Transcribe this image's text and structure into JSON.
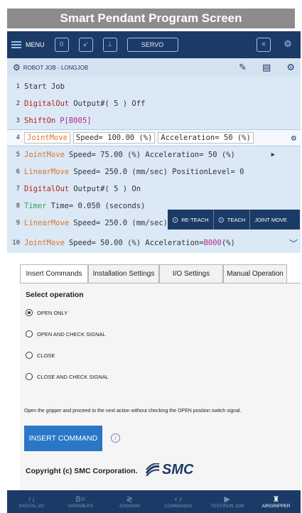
{
  "caption": "Smart Pendant Program Screen",
  "topbar": {
    "menu_label": "MENU",
    "servo_label": "SERVO"
  },
  "jobbar": {
    "title": "ROBOT JOB - LONGJOB"
  },
  "job_lines": [
    {
      "num": "1",
      "cmd": "Start Job",
      "cmd_color": "plain",
      "rest": ""
    },
    {
      "num": "2",
      "cmd": "DigitalOut",
      "cmd_color": "red",
      "rest": "Output#( 5 )  Off"
    },
    {
      "num": "3",
      "cmd": "ShiftOn",
      "cmd_color": "red",
      "rest": "P[B005]"
    },
    {
      "num": "4",
      "cmd": "JointMove",
      "cmd_color": "orange",
      "speed": "Speed= 100.00 (%)",
      "accel": "Acceleration= 50 (%)"
    },
    {
      "num": "5",
      "cmd": "JointMove",
      "cmd_color": "orange",
      "rest": "Speed= 75.00 (%)  Acceleration= 50 (%)"
    },
    {
      "num": "6",
      "cmd": "LinearMove",
      "cmd_color": "orange",
      "rest": "Speed= 250.0 (mm/sec)  PositionLevel= 0"
    },
    {
      "num": "7",
      "cmd": "DigitalOut",
      "cmd_color": "red",
      "rest": "Output#( 5 )  On"
    },
    {
      "num": "8",
      "cmd": "Timer",
      "cmd_color": "green",
      "rest": "Time= 0.050 (seconds)"
    },
    {
      "num": "9",
      "cmd": "LinearMove",
      "cmd_color": "orange",
      "rest": "Speed= 250.0 (mm/sec)"
    },
    {
      "num": "10",
      "cmd": "JointMove",
      "cmd_color": "orange",
      "rest": "Speed= 50.00 (%)  Acceleration= ",
      "rest_hl": "B000",
      "rest_tail": "(%)"
    }
  ],
  "teachbar": {
    "reteach": "RE-TEACH",
    "teach": "TEACH",
    "joint_move": "JOINT MOVE"
  },
  "tabs": [
    "Insert Commands",
    "Installation Settings",
    "I/O Settings",
    "Manual Operation"
  ],
  "panel": {
    "select_title": "Select operation",
    "options": [
      "OPEN ONLY",
      "OPEN AND CHECK SIGNAL",
      "CLOSE",
      "CLOSE AND CHECK SIGNAL"
    ],
    "selected_option": 0,
    "description": "Open the gripper and proceed to the next action without checking the OPEN position switch signal.",
    "insert_button": "INSERT COMMAND",
    "copyright": "Copyright (c) SMC Corporation.",
    "logo_text": "SMC"
  },
  "bottom_nav": [
    {
      "label": "DIGITAL I/O",
      "icon": "↑↓"
    },
    {
      "label": "VARIABLES",
      "icon": "B="
    },
    {
      "label": "JOGGING",
      "icon": "≷"
    },
    {
      "label": "COMMANDS",
      "icon": "‹ ›"
    },
    {
      "label": "TEST/RUN JOB",
      "icon": "▶"
    },
    {
      "label": "AIRGRIPPER",
      "icon": "♜"
    }
  ],
  "colors": {
    "navy": "#1c3a66",
    "accent_blue": "#2a77c6",
    "job_bg": "#dbe8f5"
  }
}
